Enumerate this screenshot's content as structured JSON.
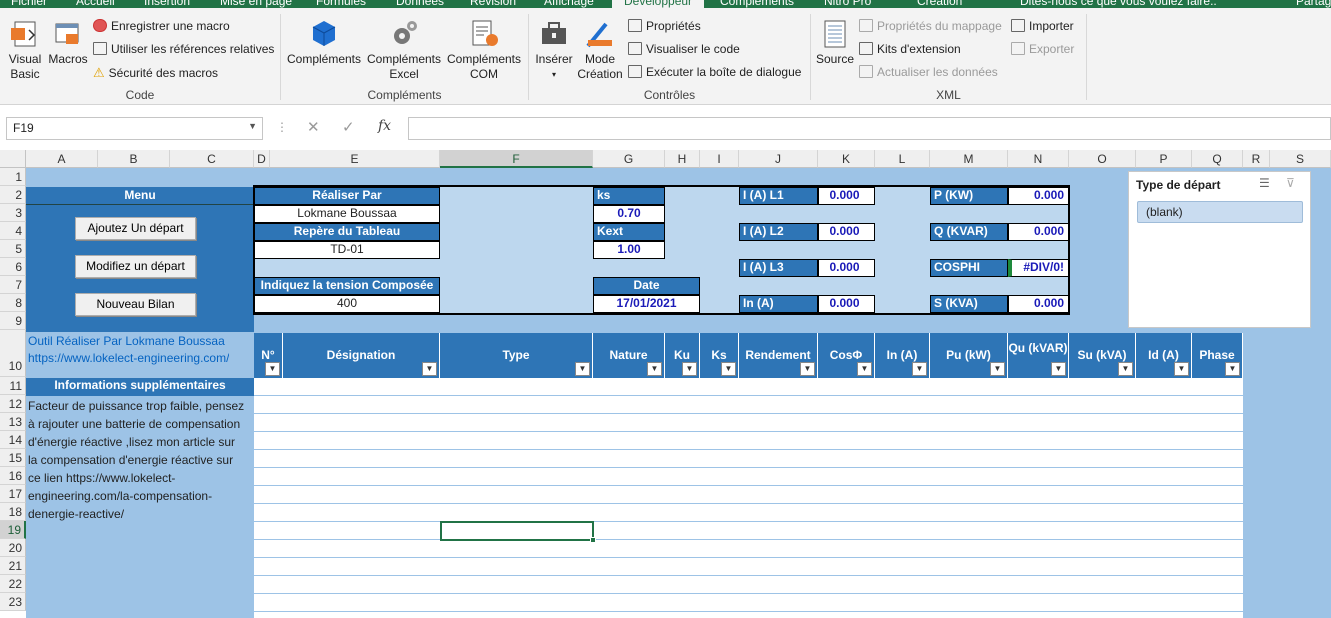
{
  "ribbon_tabs": [
    "Fichier",
    "Accueil",
    "Insertion",
    "Mise en page",
    "Formules",
    "Données",
    "Révision",
    "Affichage",
    "Développeur",
    "Compléments",
    "Nitro Pro",
    "Création",
    "Dites-nous ce que vous voulez faire..",
    "Partag"
  ],
  "groups": {
    "code": {
      "label": "Code",
      "visual_basic": "Visual\nBasic",
      "macros": "Macros",
      "record": "Enregistrer une macro",
      "relative": "Utiliser les références relatives",
      "security": "Sécurité des macros"
    },
    "complements": {
      "label": "Compléments",
      "c1": "Compléments",
      "c2": "Compléments\nExcel",
      "c3": "Compléments\nCOM"
    },
    "controles": {
      "label": "Contrôles",
      "insert": "Insérer",
      "mode": "Mode\nCréation",
      "props": "Propriétés",
      "view_code": "Visualiser le code",
      "dialog": "Exécuter la boîte de dialogue"
    },
    "xml": {
      "label": "XML",
      "source": "Source",
      "map": "Propriétés du mappage",
      "ext": "Kits d'extension",
      "refresh": "Actualiser les données",
      "import": "Importer",
      "export": "Exporter"
    }
  },
  "namebox": "F19",
  "formula": "",
  "columns": [
    "A",
    "B",
    "C",
    "D",
    "E",
    "F",
    "G",
    "H",
    "I",
    "J",
    "K",
    "L",
    "M",
    "N",
    "O",
    "P",
    "Q",
    "R",
    "S"
  ],
  "rows": [
    "1",
    "2",
    "3",
    "4",
    "5",
    "6",
    "7",
    "8",
    "9",
    "10",
    "11",
    "12",
    "13",
    "14",
    "15",
    "16",
    "17",
    "18",
    "19",
    "20",
    "21",
    "22",
    "23"
  ],
  "menu": {
    "title": "Menu",
    "btn_add": "Ajoutez Un départ",
    "btn_edit": "Modifiez un départ",
    "btn_new": "Nouveau Bilan"
  },
  "info": {
    "realise_label": "Réaliser  Par",
    "realise_value": "Lokmane Boussaa",
    "repere_label": "Repère du Tableau",
    "repere_value": "TD-01",
    "tension_label": "Indiquez la tension Composée",
    "tension_value": "400",
    "ks_label": "ks",
    "ks_value": "0.70",
    "kext_label": "Kext",
    "kext_value": "1.00",
    "date_label": "Date",
    "date_value": "17/01/2021"
  },
  "results": {
    "l1_label": "I  (A) L1",
    "l1": "0.000",
    "l2_label": "I  (A) L2",
    "l2": "0.000",
    "l3_label": "I  (A) L3",
    "l3": "0.000",
    "in_label": "In (A)",
    "in": "0.000",
    "p_label": "P (KW)",
    "p": "0.000",
    "q_label": "Q (KVAR)",
    "q": "0.000",
    "cos_label": "COSPHI",
    "cos": "#DIV/0!",
    "s_label": "S (KVA)",
    "s": "0.000"
  },
  "slicer": {
    "title": "Type de départ",
    "item": "(blank)"
  },
  "side": {
    "tool": "Outil Réaliser Par  Lokmane Boussaa",
    "url": "https://www.lokelect-engineering.com/",
    "info_title": "Informations supplémentaires",
    "lines": [
      "Facteur de puissance trop faible, pensez",
      "à rajouter une batterie de compensation",
      "d'énergie réactive  ,lisez mon article sur",
      "la compensation d'energie réactive sur",
      "ce lien https://www.lokelect-",
      "engineering.com/la-compensation-",
      "denergie-reactive/"
    ]
  },
  "table_headers": [
    "N°",
    "Désignation",
    "Type",
    "Nature",
    "Ku",
    "Ks",
    "Rendement",
    "CosΦ",
    "In (A)",
    "Pu (kW)",
    "Qu (kVAR)",
    "Su (kVA)",
    "Id (A)",
    "Phase"
  ]
}
